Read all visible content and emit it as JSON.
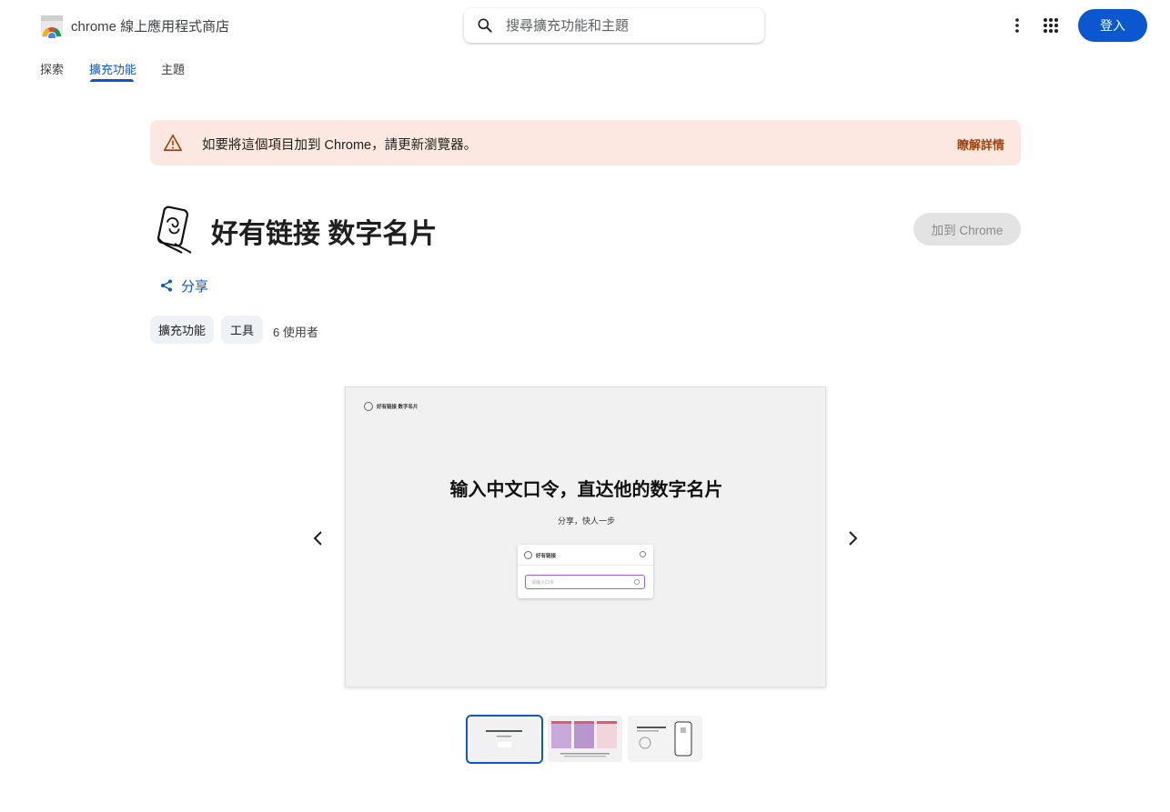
{
  "header": {
    "store_title": "chrome 線上應用程式商店",
    "search_placeholder": "搜尋擴充功能和主題",
    "signin_label": "登入"
  },
  "nav": {
    "tabs": [
      {
        "label": "探索",
        "active": false
      },
      {
        "label": "擴充功能",
        "active": true
      },
      {
        "label": "主題",
        "active": false
      }
    ]
  },
  "banner": {
    "text": "如要將這個項目加到 Chrome，請更新瀏覽器。",
    "link": "瞭解詳情",
    "background": "#fce8e1"
  },
  "extension": {
    "title": "好有链接 数字名片",
    "add_button": "加到 Chrome",
    "share_label": "分享",
    "chips": [
      "擴充功能",
      "工具"
    ],
    "users": "6 使用者"
  },
  "carousel": {
    "slide": {
      "brand": "好有链接 数字名片",
      "headline": "输入中文口令，直达他的数字名片",
      "subhead": "分享，快人一步",
      "card_brand": "好有链接",
      "card_placeholder": "请输入口令"
    },
    "thumbnails": 3,
    "active_index": 0
  },
  "colors": {
    "accent": "#0b57d0",
    "warning_link": "#a3410a"
  }
}
